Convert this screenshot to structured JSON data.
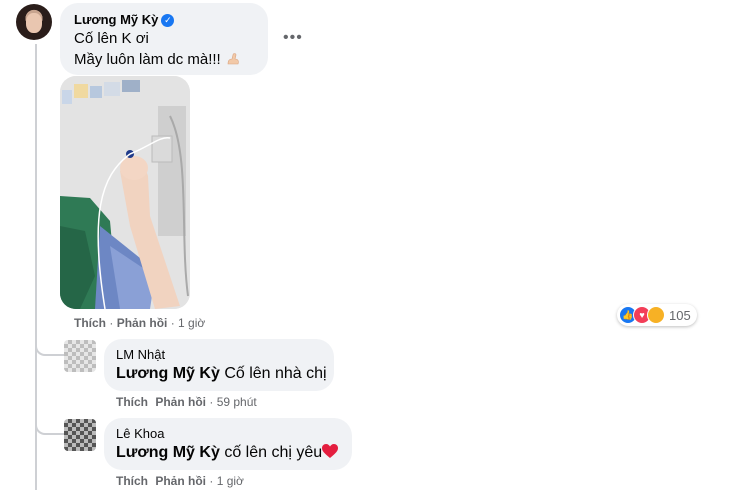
{
  "main_comment": {
    "author": "Lương Mỹ Kỳ",
    "verified_icon": "verified-badge-icon",
    "line1": "Cố lên K ơi",
    "line2": "Mầy luôn làm dc mà!!!",
    "emoji": "flexed-biceps-emoji",
    "more_icon": "ellipsis-icon",
    "more_label": "•••",
    "photo": "hospital-photo-arm-iv",
    "actions": {
      "like": "Thích",
      "reply": "Phản hồi",
      "time": "1 giờ"
    },
    "reactions": {
      "icons": [
        "like-icon",
        "love-icon",
        "care-icon"
      ],
      "count": "105"
    }
  },
  "replies": [
    {
      "author": "LM Nhật",
      "mention": "Lương Mỹ Kỳ",
      "text": "Cố lên nhà chị",
      "actions": {
        "like": "Thích",
        "reply": "Phản hồi",
        "time": "59 phút"
      }
    },
    {
      "author": "Lê Khoa",
      "mention": "Lương Mỹ Kỳ",
      "text": "cố lên chị yêu",
      "emoji": "red-heart-emoji",
      "actions": {
        "like": "Thích",
        "reply": "Phản hồi",
        "time": "1 giờ"
      }
    }
  ],
  "colors": {
    "bubble": "#f0f2f5",
    "verified": "#1877f2",
    "meta_text": "#65676b",
    "heart": "#e41e3f"
  }
}
